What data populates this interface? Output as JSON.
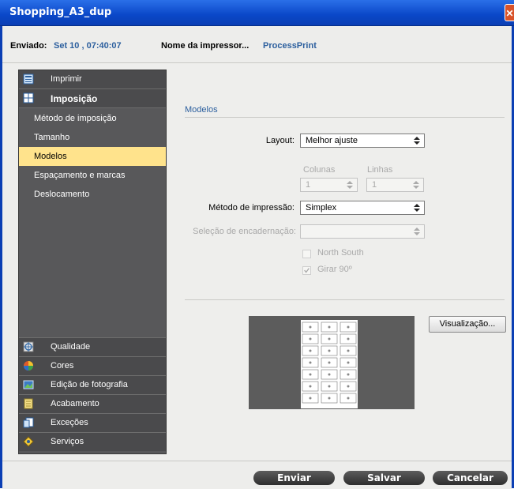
{
  "window": {
    "title": "Shopping_A3_dup"
  },
  "info": {
    "sent_label": "Enviado:",
    "sent_value": "Set 10 , 07:40:07",
    "printer_label": "Nome da impressor...",
    "printer_value": "ProcessPrint"
  },
  "sidebar": {
    "top_items": [
      {
        "label": "Imprimir",
        "icon": "print-settings-icon"
      },
      {
        "label": "Imposição",
        "icon": "imposition-icon"
      }
    ],
    "sub_items": [
      {
        "label": "Método de imposição"
      },
      {
        "label": "Tamanho"
      },
      {
        "label": "Modelos"
      },
      {
        "label": "Espaçamento e marcas"
      },
      {
        "label": "Deslocamento"
      }
    ],
    "bottom_items": [
      {
        "label": "Qualidade",
        "icon": "quality-icon"
      },
      {
        "label": "Cores",
        "icon": "colors-icon"
      },
      {
        "label": "Edição de fotografia",
        "icon": "photo-edit-icon"
      },
      {
        "label": "Acabamento",
        "icon": "finishing-icon"
      },
      {
        "label": "Exceções",
        "icon": "exceptions-icon"
      },
      {
        "label": "Serviços",
        "icon": "services-icon"
      }
    ]
  },
  "main": {
    "section_title": "Modelos",
    "layout_label": "Layout:",
    "layout_value": "Melhor ajuste",
    "columns_label": "Colunas",
    "columns_value": "1",
    "rows_label": "Linhas",
    "rows_value": "1",
    "print_method_label": "Método de impressão:",
    "print_method_value": "Simplex",
    "binding_label": "Seleção de encadernação:",
    "binding_value": "",
    "north_south_label": "North South",
    "rotate_label": "Girar 90º",
    "preview_button": "Visualização..."
  },
  "footer": {
    "send": "Enviar",
    "save": "Salvar",
    "cancel": "Cancelar"
  },
  "colors": {
    "titlebar": "#0a47c8",
    "sidebar": "#58585a",
    "active_item": "#ffe38c",
    "accent_text": "#2c5f9e"
  }
}
